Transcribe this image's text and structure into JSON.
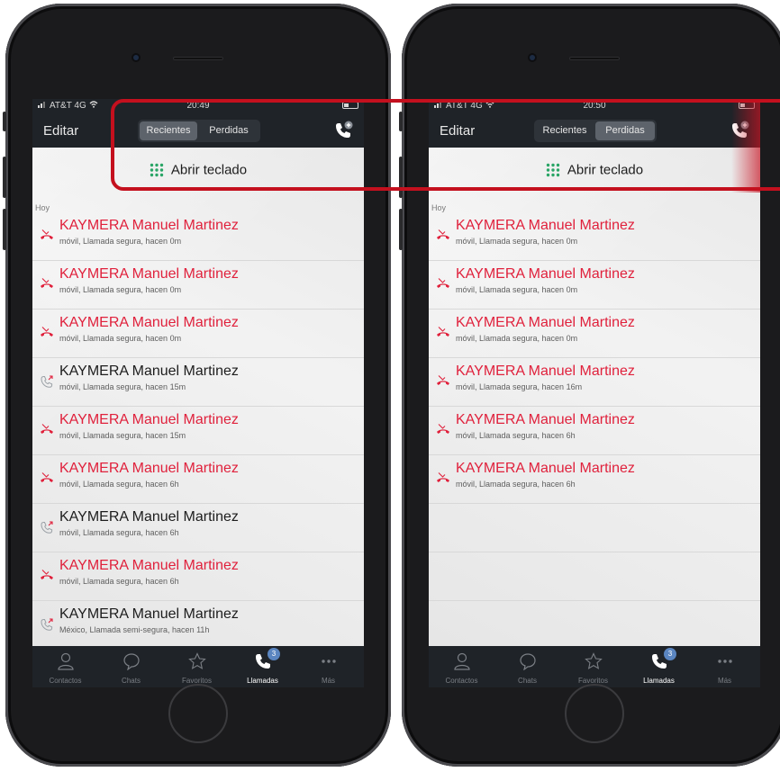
{
  "phones": [
    {
      "status": {
        "carrier": "AT&T 4G",
        "time": "20:49"
      },
      "nav": {
        "edit_label": "Editar",
        "seg_recientes": "Recientes",
        "seg_perdidas": "Perdidas",
        "active_segment": "Recientes"
      },
      "keypad_label": "Abrir teclado",
      "section_label": "Hoy",
      "calls": [
        {
          "name": "KAYMERA Manuel  Martinez",
          "detail": "móvil, Llamada segura, hacen 0m",
          "type": "missed"
        },
        {
          "name": "KAYMERA Manuel  Martinez",
          "detail": "móvil, Llamada segura, hacen 0m",
          "type": "missed"
        },
        {
          "name": "KAYMERA Manuel  Martinez",
          "detail": "móvil, Llamada segura, hacen 0m",
          "type": "missed"
        },
        {
          "name": "KAYMERA Manuel  Martinez",
          "detail": "móvil, Llamada segura, hacen 15m",
          "type": "outgoing"
        },
        {
          "name": "KAYMERA Manuel  Martinez",
          "detail": "móvil, Llamada segura, hacen 15m",
          "type": "missed"
        },
        {
          "name": "KAYMERA Manuel  Martinez",
          "detail": "móvil, Llamada segura, hacen 6h",
          "type": "missed"
        },
        {
          "name": "KAYMERA Manuel  Martinez",
          "detail": "móvil, Llamada segura, hacen 6h",
          "type": "outgoing"
        },
        {
          "name": "KAYMERA Manuel  Martinez",
          "detail": "móvil, Llamada segura, hacen 6h",
          "type": "missed"
        },
        {
          "name": "KAYMERA Manuel  Martinez",
          "detail": "México, Llamada semi-segura, hacen 11h",
          "type": "outgoing"
        }
      ],
      "tabs": {
        "contactos": "Contactos",
        "chats": "Chats",
        "favoritos": "Favoritos",
        "llamadas": "Llamadas",
        "mas": "Más",
        "badge": "3"
      }
    },
    {
      "status": {
        "carrier": "AT&T 4G",
        "time": "20:50"
      },
      "nav": {
        "edit_label": "Editar",
        "seg_recientes": "Recientes",
        "seg_perdidas": "Perdidas",
        "active_segment": "Perdidas"
      },
      "keypad_label": "Abrir teclado",
      "section_label": "Hoy",
      "calls": [
        {
          "name": "KAYMERA Manuel  Martinez",
          "detail": "móvil, Llamada segura, hacen 0m",
          "type": "missed"
        },
        {
          "name": "KAYMERA Manuel  Martinez",
          "detail": "móvil, Llamada segura, hacen 0m",
          "type": "missed"
        },
        {
          "name": "KAYMERA Manuel  Martinez",
          "detail": "móvil, Llamada segura, hacen 0m",
          "type": "missed"
        },
        {
          "name": "KAYMERA Manuel  Martinez",
          "detail": "móvil, Llamada segura, hacen 16m",
          "type": "missed"
        },
        {
          "name": "KAYMERA Manuel  Martinez",
          "detail": "móvil, Llamada segura, hacen 6h",
          "type": "missed"
        },
        {
          "name": "KAYMERA Manuel  Martinez",
          "detail": "móvil, Llamada segura, hacen 6h",
          "type": "missed"
        }
      ],
      "tabs": {
        "contactos": "Contactos",
        "chats": "Chats",
        "favoritos": "Favoritos",
        "llamadas": "Llamadas",
        "mas": "Más",
        "badge": "3"
      }
    }
  ],
  "colors": {
    "missed": "#e0213c",
    "bar": "#1f2328",
    "highlight": "#c4101e",
    "accent_green": "#2aa566",
    "badge": "#5a85c0"
  }
}
